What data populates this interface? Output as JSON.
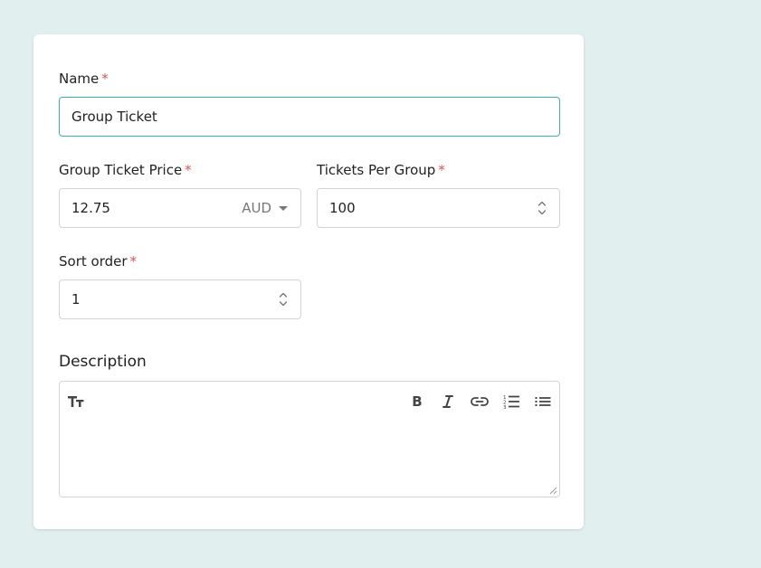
{
  "form": {
    "name": {
      "label": "Name",
      "required_mark": "*",
      "value": "Group Ticket"
    },
    "price": {
      "label": "Group Ticket Price",
      "required_mark": "*",
      "value": "12.75",
      "currency": "AUD"
    },
    "per_group": {
      "label": "Tickets Per Group",
      "required_mark": "*",
      "value": "100"
    },
    "sort_order": {
      "label": "Sort order",
      "required_mark": "*",
      "value": "1"
    },
    "description": {
      "title": "Description",
      "value": ""
    }
  },
  "editor_toolbar": {
    "icons": [
      "text-size-icon",
      "bold-icon",
      "italic-icon",
      "link-icon",
      "ordered-list-icon",
      "bullet-list-icon"
    ]
  },
  "colors": {
    "background": "#e2efef",
    "focus_border": "#3bb3ac",
    "required": "#e05252"
  }
}
